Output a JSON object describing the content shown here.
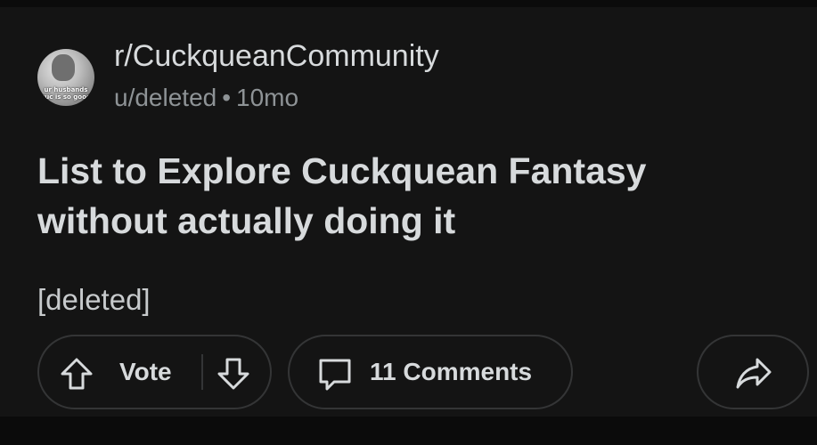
{
  "post": {
    "subreddit": "r/CuckqueanCommunity",
    "author": "u/deleted",
    "separator": "•",
    "age": "10mo",
    "title": "List to Explore Cuckquean Fantasy without actually doing it",
    "body": "[deleted]",
    "avatar_caption": "ur husbands cuc is so good"
  },
  "actions": {
    "vote_label": "Vote",
    "comments_label": "11 Comments"
  },
  "icons": {
    "upvote": "arrow-up-icon",
    "downvote": "arrow-down-icon",
    "comments": "speech-bubble-icon",
    "share": "share-arrow-icon"
  },
  "colors": {
    "background": "#141414",
    "text": "#d7dadc",
    "muted": "#8e9396",
    "border": "#343536"
  }
}
